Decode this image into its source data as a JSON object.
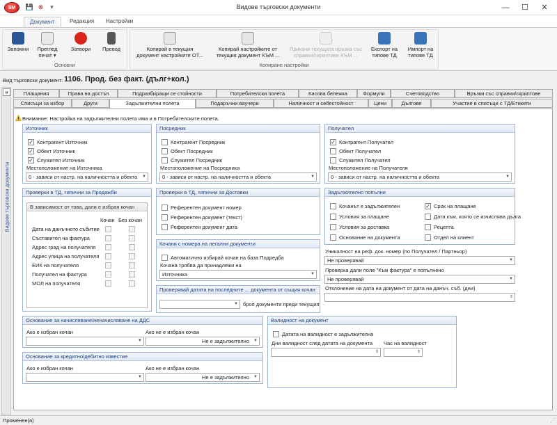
{
  "window": {
    "title": "Видове търговски документи",
    "logo": "SM",
    "minimize": "—",
    "maximize": "☐",
    "close": "✕"
  },
  "ribbon": {
    "tabs": [
      "Документ",
      "Редакция",
      "Настройки"
    ],
    "groups": [
      {
        "label": "Основни"
      },
      {
        "label": "Копиране настройки"
      }
    ],
    "buttons": [
      {
        "l1": "Запомни",
        "l2": ""
      },
      {
        "l1": "Преглед",
        "l2": "печат ▾"
      },
      {
        "l1": "Затвори",
        "l2": ""
      },
      {
        "l1": "Превод",
        "l2": ""
      },
      {
        "l1": "Копирай в текущия",
        "l2": "документ настройките ОТ..."
      },
      {
        "l1": "Копирай настройките от",
        "l2": "текущия документ КЪМ ..."
      },
      {
        "l1": "Прикачи текущата връзка със",
        "l2": "справки/скриптове КЪМ ..."
      },
      {
        "l1": "Експорт на",
        "l2": "типове ТД"
      },
      {
        "l1": "Импорт на",
        "l2": "типове ТД"
      }
    ]
  },
  "doctype": {
    "label": "Вид търговски документ:",
    "value": "1106. Прод. без факт. (дълг+кол.)"
  },
  "sidepanel": {
    "collapse": "»",
    "title": "Видове търговски документи"
  },
  "tabs_row1": [
    "Плащания",
    "Права на достъп",
    "Подразбиращи се стойности",
    "Потребителски полета",
    "Касова бележка",
    "Формули",
    "Счетоводство",
    "Връзки със справки/скриптове"
  ],
  "tabs_row2": [
    "Списъци за избор",
    "Други",
    "Задължителни полета",
    "Подаръчни ваучери",
    "Наличност и себестойност",
    "Цени",
    "Дългове",
    "Участие в списъци с ТД/Етикети"
  ],
  "warning": "Внимание: Настройка на задължителни полета има и в Потребителските полета.",
  "source": {
    "title": "Източник",
    "items": [
      {
        "label": "Контрагент Източник",
        "checked": "✓"
      },
      {
        "label": "Обект Източник",
        "checked": "✓"
      },
      {
        "label": "Служител Източник",
        "checked": "✓"
      }
    ],
    "loc_label": "Местоположение на Източника",
    "loc_value": "0 - зависи от настр. на наличността и обекта"
  },
  "intermediary": {
    "title": "Посредник",
    "items": [
      {
        "label": "Контрагент Посредник",
        "checked": ""
      },
      {
        "label": "Обект Посредник",
        "checked": ""
      },
      {
        "label": "Служител Посредник",
        "checked": ""
      }
    ],
    "loc_label": "Местоположение на Посредника",
    "loc_value": "0 - зависи от настр. на наличността и обекта"
  },
  "receiver": {
    "title": "Получател",
    "items": [
      {
        "label": "Контрагент Получател",
        "checked": "✓"
      },
      {
        "label": "Обект Получател",
        "checked": ""
      },
      {
        "label": "Служител Получател",
        "checked": ""
      }
    ],
    "loc_label": "Местоположение на Получателя",
    "loc_value": "0 - зависи от настр. на наличността и обекта"
  },
  "sales": {
    "title": "Проверки в ТД, типични за Продажби",
    "inner_title": "В зависимост от това, дали е избран кочан",
    "col1": "Кочан",
    "col2": "Без кочан",
    "rows": [
      "Дата на данъчното събитие",
      "Съставител на фактура",
      "Адрес град на получателя",
      "Адрес улица на получателя",
      "ЕИК на получателя",
      "Получател на фактура",
      "МОЛ на получателя"
    ]
  },
  "delivery": {
    "title": "Проверки в ТД, типични за Доставки",
    "items": [
      "Референтен документ номер",
      "Референтен документ (текст)",
      "Референтен документ дата"
    ]
  },
  "mandatory": {
    "title": "Задължително попълни",
    "left": [
      {
        "label": "Кочанът е задължителен",
        "checked": ""
      },
      {
        "label": "Условия за плащане",
        "checked": ""
      },
      {
        "label": "Условия за доставка",
        "checked": ""
      },
      {
        "label": "Основание на документа",
        "checked": ""
      }
    ],
    "right": [
      {
        "label": "Срок на плащане",
        "checked": "✓"
      },
      {
        "label": "Дата към, която се изчислява дълга",
        "checked": ""
      },
      {
        "label": "Рецепта",
        "checked": ""
      },
      {
        "label": "Отдел на клиент",
        "checked": ""
      }
    ]
  },
  "legal": {
    "title": "Кочани с номера на легални документи",
    "auto_label": "Автоматично избирай кочан на база Подредба",
    "belong_label": "Кочана трябва да принадлежи на",
    "belong_value": "Източника"
  },
  "uniq": {
    "label": "Уникалност на реф. док. номер (по Получател / Партньор)",
    "value": "Не проверявай",
    "check_label": "Проверка дали поле \"Към фактура\" е попълнено",
    "check_value": "Не проверявай",
    "dev_label": "Отклонение на дата на документ от дата на данъч. съб. (дни)",
    "dev_value": ""
  },
  "lastdocs": {
    "title": "Проверявай датата на последните ... документа от същия кочан",
    "value": "",
    "suffix": "броя документи преди текущия"
  },
  "vat": {
    "title": "Основание за начисляване/неначисляване на ДДС",
    "sel_label": "Ако е избран кочан",
    "sel_value": "",
    "notsel_label": "Ако не е избран кочан",
    "notsel_value": "Не е задължително"
  },
  "credit": {
    "title": "Основание за кредитно/дебитно известие",
    "sel_label": "Ако е избран кочан",
    "sel_value": "",
    "notsel_label": "Ако не е избран кочан",
    "notsel_value": "Не е задължително"
  },
  "validity": {
    "title": "Валидност на документ",
    "mand_label": "Датата на валидност е задължителна",
    "days_label": "Дни валидност след датата на документа",
    "hour_label": "Час на валидност",
    "days_value": "",
    "hour_value": ""
  },
  "status": {
    "text": "Променен(а)",
    "grip": "⋰"
  },
  "colors": {
    "accent": "#2b5797",
    "group_border": "#9db3d6",
    "logo_red": "#c0141c"
  }
}
